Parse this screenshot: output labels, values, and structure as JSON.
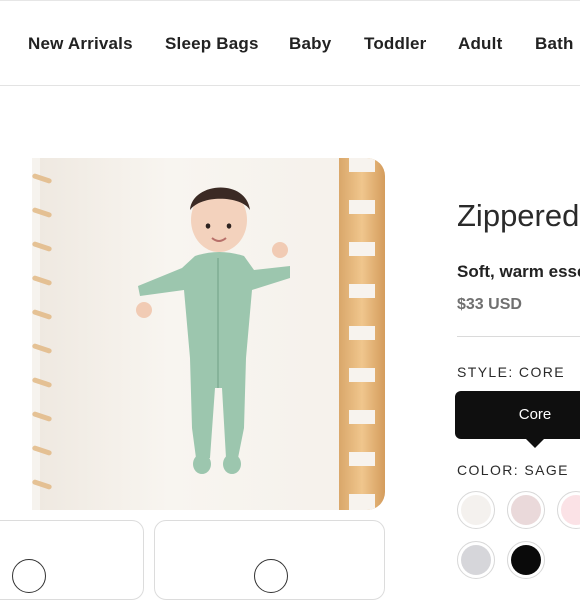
{
  "nav": {
    "items": [
      {
        "label": "New Arrivals"
      },
      {
        "label": "Sleep Bags"
      },
      {
        "label": "Baby"
      },
      {
        "label": "Toddler"
      },
      {
        "label": "Adult"
      },
      {
        "label": "Bath"
      }
    ]
  },
  "product": {
    "title": "Zippered",
    "subtitle": "Soft, warm esse",
    "price": "$33 USD",
    "style_label": "STYLE: CORE",
    "style_option": "Core",
    "color_label": "COLOR: SAGE",
    "colors": [
      {
        "name": "cloud",
        "hex": "#f4f1ee"
      },
      {
        "name": "blush",
        "hex": "#ead9da"
      },
      {
        "name": "pink",
        "hex": "#fbe2e6"
      },
      {
        "name": "heather-gray",
        "hex": "#d6d6da"
      },
      {
        "name": "midnight",
        "hex": "#0a0a0a"
      }
    ],
    "image_colors": {
      "romper": "#9cc6ae",
      "crib_wood": "#e3b27a",
      "sheet": "#f6f2ec"
    }
  }
}
